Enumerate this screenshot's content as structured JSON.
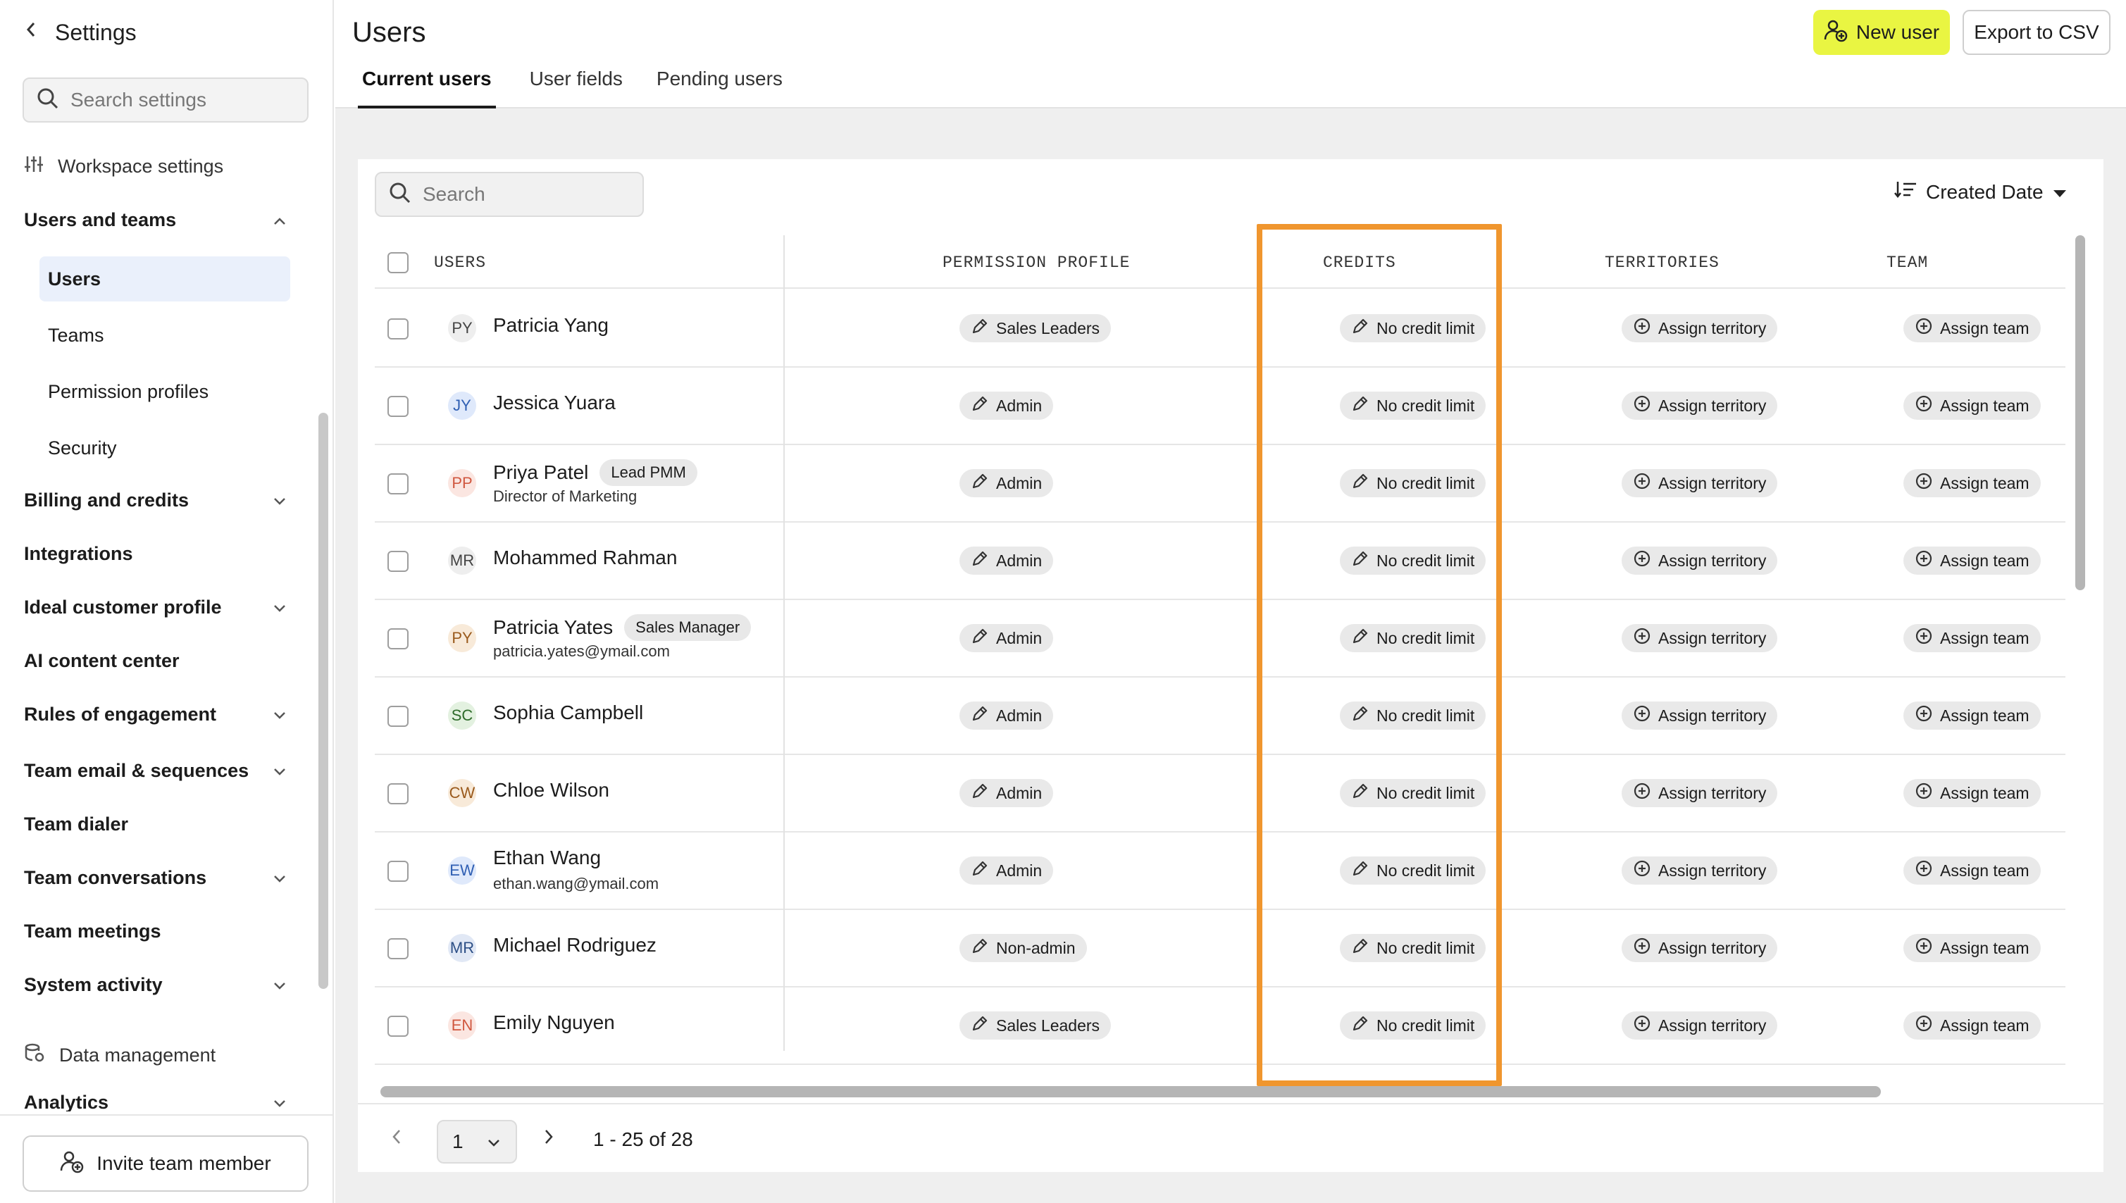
{
  "sidebar": {
    "title": "Settings",
    "search_placeholder": "Search settings",
    "workspace_settings": "Workspace settings",
    "users_and_teams": "Users and teams",
    "sub_items": [
      "Users",
      "Teams",
      "Permission profiles",
      "Security"
    ],
    "sections": [
      "Billing and credits",
      "Integrations",
      "Ideal customer profile",
      "AI content center",
      "Rules of engagement",
      "Team email & sequences",
      "Team dialer",
      "Team conversations",
      "Team meetings",
      "System activity"
    ],
    "data_management": "Data management",
    "analytics": "Analytics",
    "invite_button": "Invite team member"
  },
  "header": {
    "title": "Users",
    "tabs": [
      "Current users",
      "User fields",
      "Pending users"
    ],
    "new_user": "New user",
    "export": "Export to CSV",
    "accent_color": "#e9f542"
  },
  "table": {
    "search_placeholder": "Search",
    "sort_label": "Created Date",
    "columns": [
      "USERS",
      "PERMISSION PROFILE",
      "CREDITS",
      "TERRITORIES",
      "TEAM"
    ],
    "credit_label": "No credit limit",
    "territory_label": "Assign territory",
    "team_label": "Assign team",
    "rows": [
      {
        "initials": "PY",
        "name": "Patricia Yang",
        "tag": "",
        "sub": "",
        "profile": "Sales Leaders",
        "avatar_bg": "#eeeeee",
        "avatar_fg": "#444444"
      },
      {
        "initials": "JY",
        "name": "Jessica Yuara",
        "tag": "",
        "sub": "",
        "profile": "Admin",
        "avatar_bg": "#dfe9fb",
        "avatar_fg": "#2f5fb3"
      },
      {
        "initials": "PP",
        "name": "Priya Patel",
        "tag": "Lead PMM",
        "sub": "Director of Marketing",
        "profile": "Admin",
        "avatar_bg": "#fbe6e1",
        "avatar_fg": "#d0573f"
      },
      {
        "initials": "MR",
        "name": "Mohammed Rahman",
        "tag": "",
        "sub": "",
        "profile": "Admin",
        "avatar_bg": "#eeeeee",
        "avatar_fg": "#444444"
      },
      {
        "initials": "PY",
        "name": "Patricia Yates",
        "tag": "Sales Manager",
        "sub": "patricia.yates@ymail.com",
        "profile": "Admin",
        "avatar_bg": "#f8ead9",
        "avatar_fg": "#9a5a1c"
      },
      {
        "initials": "SC",
        "name": "Sophia Campbell",
        "tag": "",
        "sub": "",
        "profile": "Admin",
        "avatar_bg": "#e3f1e0",
        "avatar_fg": "#2e6b2a"
      },
      {
        "initials": "CW",
        "name": "Chloe Wilson",
        "tag": "",
        "sub": "",
        "profile": "Admin",
        "avatar_bg": "#f8ead9",
        "avatar_fg": "#9a5a1c"
      },
      {
        "initials": "EW",
        "name": "Ethan Wang",
        "tag": "",
        "sub": "ethan.wang@ymail.com",
        "profile": "Admin",
        "avatar_bg": "#dfe9fb",
        "avatar_fg": "#2f5fb3"
      },
      {
        "initials": "MR",
        "name": "Michael Rodriguez",
        "tag": "",
        "sub": "",
        "profile": "Non-admin",
        "avatar_bg": "#e1e8f5",
        "avatar_fg": "#2d4f86"
      },
      {
        "initials": "EN",
        "name": "Emily Nguyen",
        "tag": "",
        "sub": "",
        "profile": "Sales Leaders",
        "avatar_bg": "#fbe6e1",
        "avatar_fg": "#d0573f"
      }
    ],
    "highlight_color": "#f0962e"
  },
  "pagination": {
    "page": "1",
    "range": "1 - 25 of 28"
  }
}
